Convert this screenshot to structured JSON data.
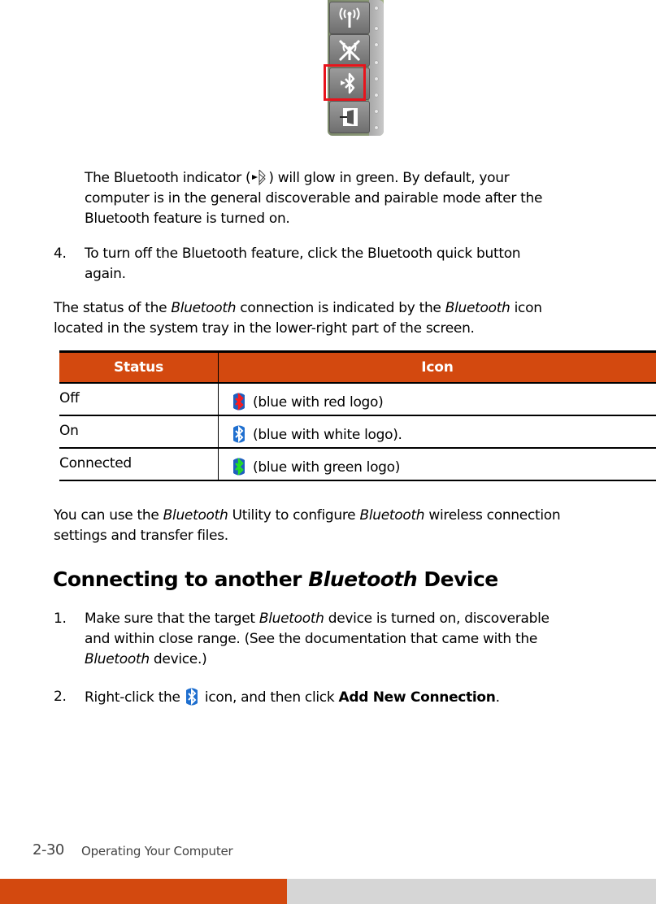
{
  "quick_buttons": {
    "items": [
      {
        "name": "wireless",
        "icon": "wireless-antenna-icon"
      },
      {
        "name": "wireless-off",
        "icon": "wireless-disabled-icon"
      },
      {
        "name": "bluetooth",
        "icon": "bluetooth-icon",
        "selected": true
      },
      {
        "name": "exit",
        "icon": "exit-door-icon"
      }
    ],
    "highlight_color": "#e8141c"
  },
  "intro": {
    "indicator_before": "The Bluetooth indicator (",
    "indicator_after": ") will glow in green. By default, your",
    "line2": "computer is in the general discoverable and pairable mode after the",
    "line3": "Bluetooth feature is turned on."
  },
  "step4": {
    "number": "4.",
    "line1": "To turn off the Bluetooth feature, click the Bluetooth quick button",
    "line2": "again."
  },
  "status_para": {
    "p1": "The status of the ",
    "em1": "Bluetooth",
    "p2": " connection is indicated by the ",
    "em2": "Bluetooth",
    "p3": " icon",
    "line2": "located in the system tray in the lower-right part of the screen."
  },
  "table": {
    "header_color": "#d3490f",
    "headers": [
      "Status",
      "Icon"
    ],
    "rows": [
      {
        "status": "Off",
        "description": "(blue with red logo)",
        "logo_color": "#ff1a1a",
        "icon": "bluetooth-off-icon"
      },
      {
        "status": "On",
        "description": "(blue with white logo).",
        "logo_color": "#ffffff",
        "icon": "bluetooth-on-icon"
      },
      {
        "status": "Connected",
        "description": "(blue with green logo)",
        "logo_color": "#22e022",
        "icon": "bluetooth-connected-icon"
      }
    ]
  },
  "utility_para": {
    "p1": "You can use the ",
    "em1": "Bluetooth",
    "p2": " Utility to configure ",
    "em2": "Bluetooth",
    "p3": " wireless connection",
    "line2": "settings and transfer files."
  },
  "section": {
    "title_before": "Connecting to another ",
    "title_em": "Bluetooth",
    "title_after": " Device"
  },
  "steps": [
    {
      "number": "1.",
      "l1_before": "Make sure that the target ",
      "l1_em": "Bluetooth",
      "l1_after": " device is turned on, discoverable",
      "line2": "and within close range. (See the documentation that came with the",
      "l3_em": "Bluetooth",
      "l3_after": " device.)"
    },
    {
      "number": "2.",
      "before": "Right-click the ",
      "after": " icon, and then click ",
      "bold": "Add New Connection",
      "end": "."
    }
  ],
  "footer": {
    "page_number": "2-30",
    "chapter_title": "Operating Your Computer",
    "accent_color": "#d3490f"
  }
}
